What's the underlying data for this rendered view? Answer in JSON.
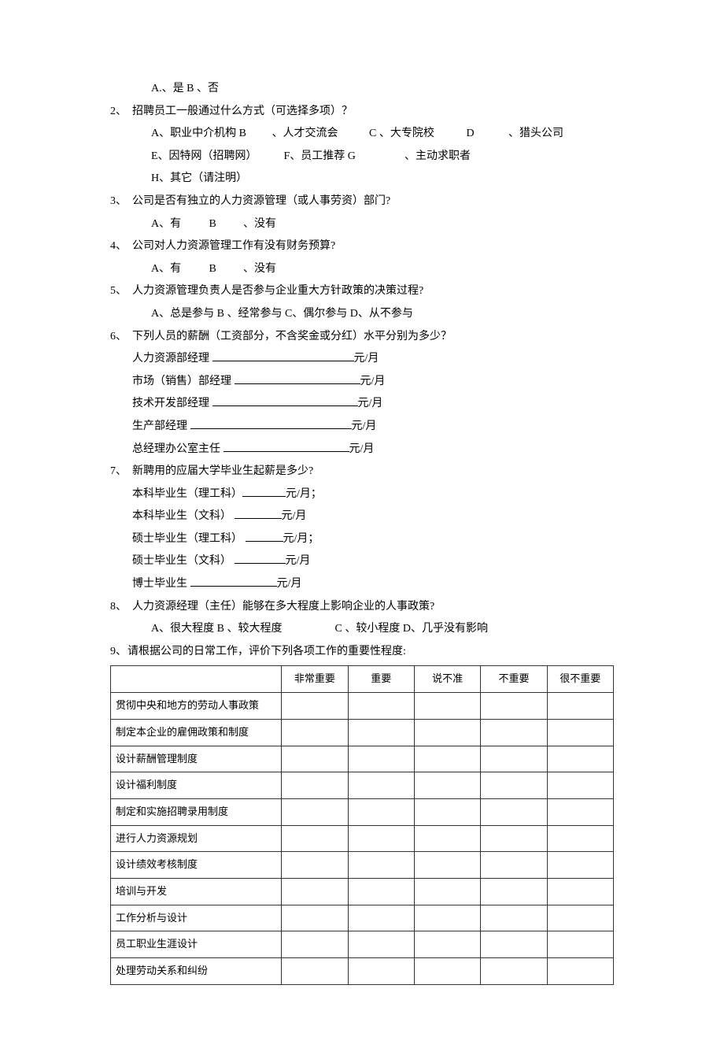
{
  "q1": {
    "opts": "A.、是 B 、否"
  },
  "q2": {
    "num": "2、",
    "text": "招聘员工一般通过什么方式（可选择多项）？",
    "line1_a": "A、职业中介机构 B",
    "line1_b": "、人才交流会",
    "line1_c": "C 、大专院校",
    "line1_d": "D",
    "line1_e": "、猎头公司",
    "line2_a": "E、因特网（招聘网）",
    "line2_b": "F、员工推荐 G",
    "line2_c": "、主动求职者",
    "line3": "H、其它（请注明）"
  },
  "q3": {
    "num": "3、",
    "text": "公司是否有独立的人力资源管理（或人事劳资）部门?",
    "opts_a": "A、有",
    "opts_b": "B",
    "opts_c": "、没有"
  },
  "q4": {
    "num": "4、",
    "text": "公司对人力资源管理工作有没有财务预算?",
    "opts_a": "A、有",
    "opts_b": "B",
    "opts_c": "、没有"
  },
  "q5": {
    "num": "5、",
    "text": "人力资源管理负责人是否参与企业重大方针政策的决策过程?",
    "opts": "A、总是参与 B 、经常参与 C、偶尔参与 D、从不参与"
  },
  "q6": {
    "num": "6、",
    "text": "下列人员的薪酬（工资部分，不含奖金或分红）水平分别为多少？",
    "r1a": "人力资源部经理  ",
    "r1b": "元/月",
    "r2a": "市场（销售）部经理 ",
    "r2b": "元/月",
    "r3a": "技术开发部经理 ",
    "r3b": "元/月",
    "r4a": "生产部经理  ",
    "r4b": "元/月",
    "r5a": "总经理办公室主任  ",
    "r5b": "元/月"
  },
  "q7": {
    "num": "7、",
    "text": "新聘用的应届大学毕业生起薪是多少?",
    "r1a": "本科毕业生（理工科）",
    "r1b": "元/月；",
    "r2a": "本科毕业生（文科） ",
    "r2b": "元/月",
    "r3a": "硕士毕业生（理工科） ",
    "r3b": "元/月；",
    "r4a": "硕士毕业生（文科） ",
    "r4b": "元/月",
    "r5a": "博士毕业生  ",
    "r5b": "元/月"
  },
  "q8": {
    "num": "8、",
    "text": "人力资源经理（主任）能够在多大程度上影响企业的人事政策?",
    "opts_a": "A、很大程度  B 、较大程度",
    "opts_b": "C 、较小程度  D、几乎没有影响"
  },
  "q9": {
    "num": "9、",
    "text": "请根据公司的日常工作，评价下列各项工作的重要性程度:",
    "headers": [
      "非常重要",
      "重要",
      "说不准",
      "不重要",
      "很不重要"
    ],
    "rows": [
      "贯彻中央和地方的劳动人事政策",
      "制定本企业的雇佣政策和制度",
      "设计薪酬管理制度",
      "设计福利制度",
      "制定和实施招聘录用制度",
      "进行人力资源规划",
      "设计绩效考核制度",
      "培训与开发",
      "工作分析与设计",
      "员工职业生涯设计",
      "处理劳动关系和纠纷"
    ]
  }
}
